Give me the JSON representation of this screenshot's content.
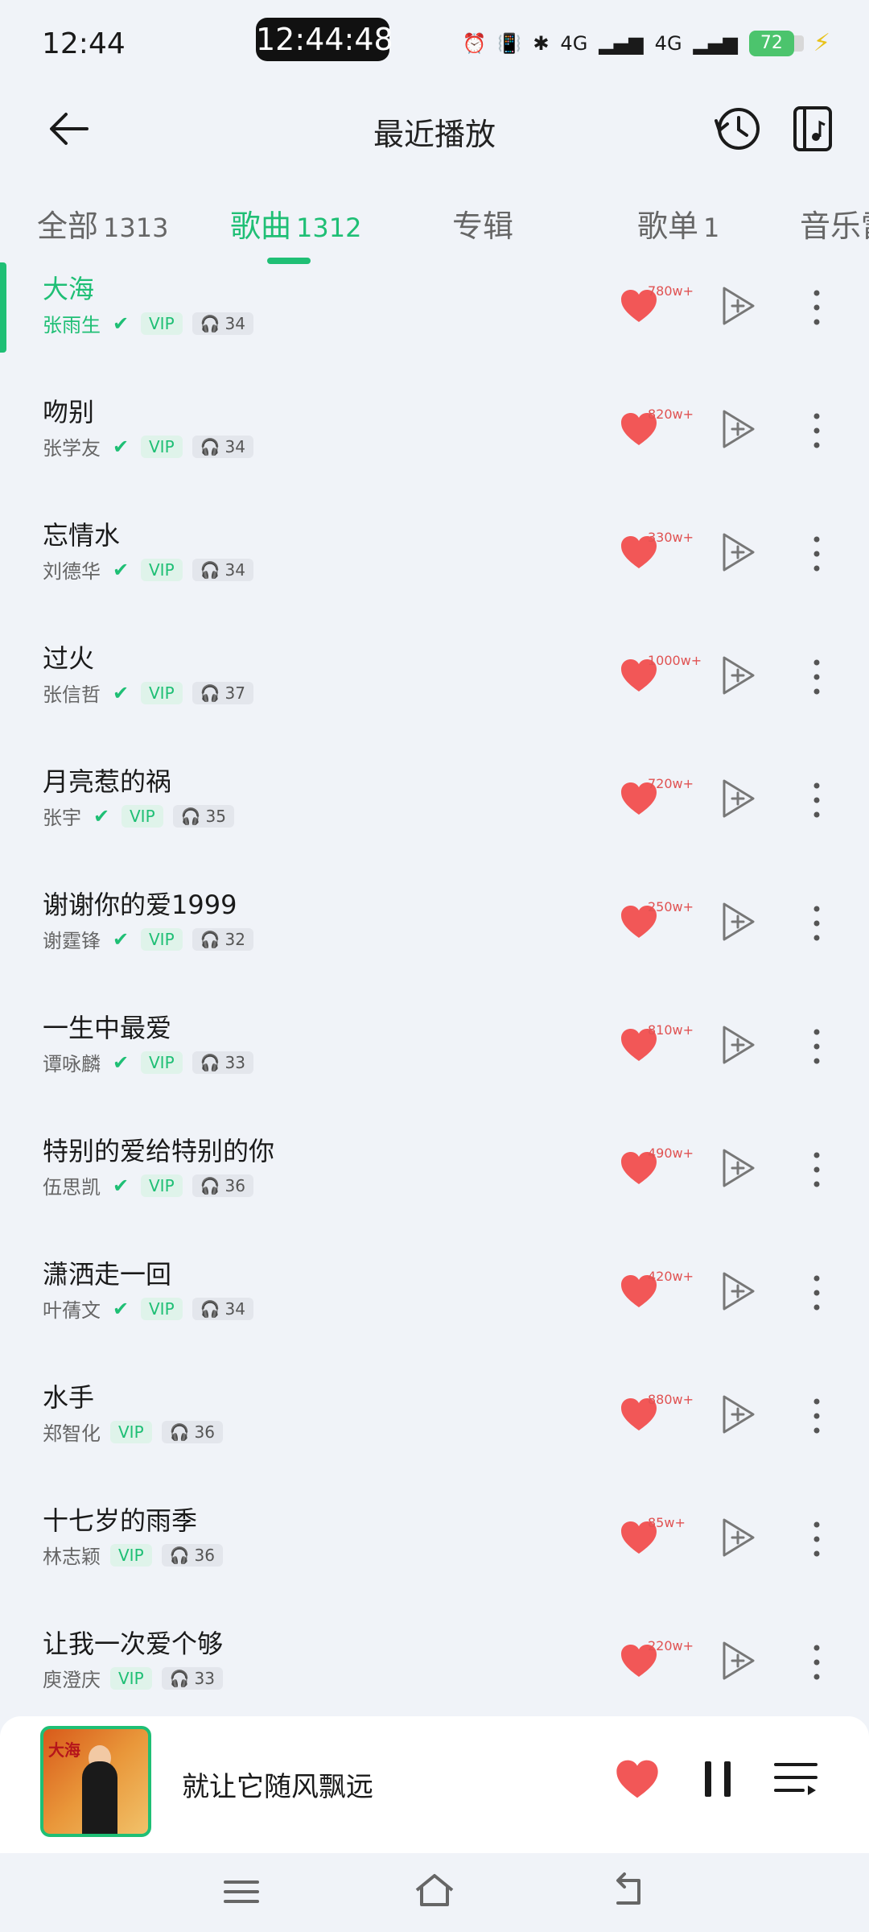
{
  "status_bar": {
    "time": "12:44",
    "clock_pill": "12:44:48",
    "network1": "4G",
    "network2": "4G",
    "battery": "72"
  },
  "header": {
    "title": "最近播放"
  },
  "tabs": [
    {
      "label": "全部",
      "count": "1313"
    },
    {
      "label": "歌曲",
      "count": "1312"
    },
    {
      "label": "专辑",
      "count": ""
    },
    {
      "label": "歌单",
      "count": "1"
    },
    {
      "label": "音乐雷",
      "count": ""
    }
  ],
  "songs": [
    {
      "title": "大海",
      "artist": "张雨生",
      "verified": true,
      "vip": "VIP",
      "plays": "34",
      "likes": "780w+",
      "playing": true
    },
    {
      "title": "吻别",
      "artist": "张学友",
      "verified": true,
      "vip": "VIP",
      "plays": "34",
      "likes": "820w+"
    },
    {
      "title": "忘情水",
      "artist": "刘德华",
      "verified": true,
      "vip": "VIP",
      "plays": "34",
      "likes": "330w+"
    },
    {
      "title": "过火",
      "artist": "张信哲",
      "verified": true,
      "vip": "VIP",
      "plays": "37",
      "likes": "1000w+"
    },
    {
      "title": "月亮惹的祸",
      "artist": "张宇",
      "verified": true,
      "vip": "VIP",
      "plays": "35",
      "likes": "720w+"
    },
    {
      "title": "谢谢你的爱1999",
      "artist": "谢霆锋",
      "verified": true,
      "vip": "VIP",
      "plays": "32",
      "likes": "250w+"
    },
    {
      "title": "一生中最爱",
      "artist": "谭咏麟",
      "verified": true,
      "vip": "VIP",
      "plays": "33",
      "likes": "810w+"
    },
    {
      "title": "特别的爱给特别的你",
      "artist": "伍思凯",
      "verified": true,
      "vip": "VIP",
      "plays": "36",
      "likes": "490w+"
    },
    {
      "title": "潇洒走一回",
      "artist": "叶蒨文",
      "verified": true,
      "vip": "VIP",
      "plays": "34",
      "likes": "420w+"
    },
    {
      "title": "水手",
      "artist": "郑智化",
      "verified": false,
      "vip": "VIP",
      "plays": "36",
      "likes": "880w+"
    },
    {
      "title": "十七岁的雨季",
      "artist": "林志颖",
      "verified": false,
      "vip": "VIP",
      "plays": "36",
      "likes": "85w+"
    },
    {
      "title": "让我一次爱个够",
      "artist": "庾澄庆",
      "verified": false,
      "vip": "VIP",
      "plays": "33",
      "likes": "220w+"
    }
  ],
  "player": {
    "now_playing": "就让它随风飘远"
  },
  "icons": {
    "back": "back-arrow-icon",
    "history": "history-clock-icon",
    "local_music": "music-file-icon",
    "heart": "heart-icon",
    "add_to_playlist": "add-to-playlist-icon",
    "more": "more-vertical-icon",
    "pause": "pause-icon",
    "queue": "playlist-queue-icon"
  },
  "colors": {
    "accent": "#1fbf75",
    "heart": "#f25757",
    "background": "#f0f3f8"
  }
}
